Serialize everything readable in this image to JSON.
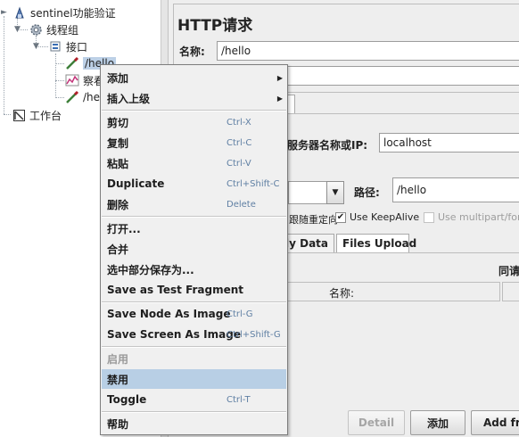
{
  "tree": {
    "root": "sentinel功能验证",
    "thread_group": "线程组",
    "controller": "接口",
    "sampler_1": "/hello",
    "listener": "察看",
    "sampler_2": "/he",
    "workbench": "工作台"
  },
  "panel": {
    "title": "HTTP请求",
    "name_label": "名称:",
    "name_value": "/hello",
    "server_label": "服务器名称或IP:",
    "server_value": "localhost",
    "path_label": "路径:",
    "path_value": "/hello",
    "redirect_label": "跟随重定向",
    "keepalive_label": "Use KeepAlive",
    "multipart_label": "Use multipart/form-",
    "tab_body": "Body Data",
    "tab_files": "Files Upload",
    "send_label": "同请",
    "col_name": "名称:",
    "btn_detail": "Detail",
    "btn_add": "添加",
    "btn_add_from": "Add fro"
  },
  "menu": {
    "add": "添加",
    "insert_parent": "插入上级",
    "cut": "剪切",
    "cut_sc": "Ctrl-X",
    "copy": "复制",
    "copy_sc": "Ctrl-C",
    "paste": "粘贴",
    "paste_sc": "Ctrl-V",
    "duplicate": "Duplicate",
    "duplicate_sc": "Ctrl+Shift-C",
    "delete": "删除",
    "delete_sc": "Delete",
    "open": "打开...",
    "merge": "合并",
    "save_selection": "选中部分保存为...",
    "save_fragment": "Save as Test Fragment",
    "save_node_image": "Save Node As Image",
    "save_node_image_sc": "Ctrl-G",
    "save_screen_image": "Save Screen As Image",
    "save_screen_image_sc": "Ctrl+Shift-G",
    "enable": "启用",
    "disable": "禁用",
    "toggle": "Toggle",
    "toggle_sc": "Ctrl-T",
    "help": "帮助"
  },
  "colors": {
    "menu_highlight": "#b8cfe5",
    "selection": "#bcd0e6"
  }
}
